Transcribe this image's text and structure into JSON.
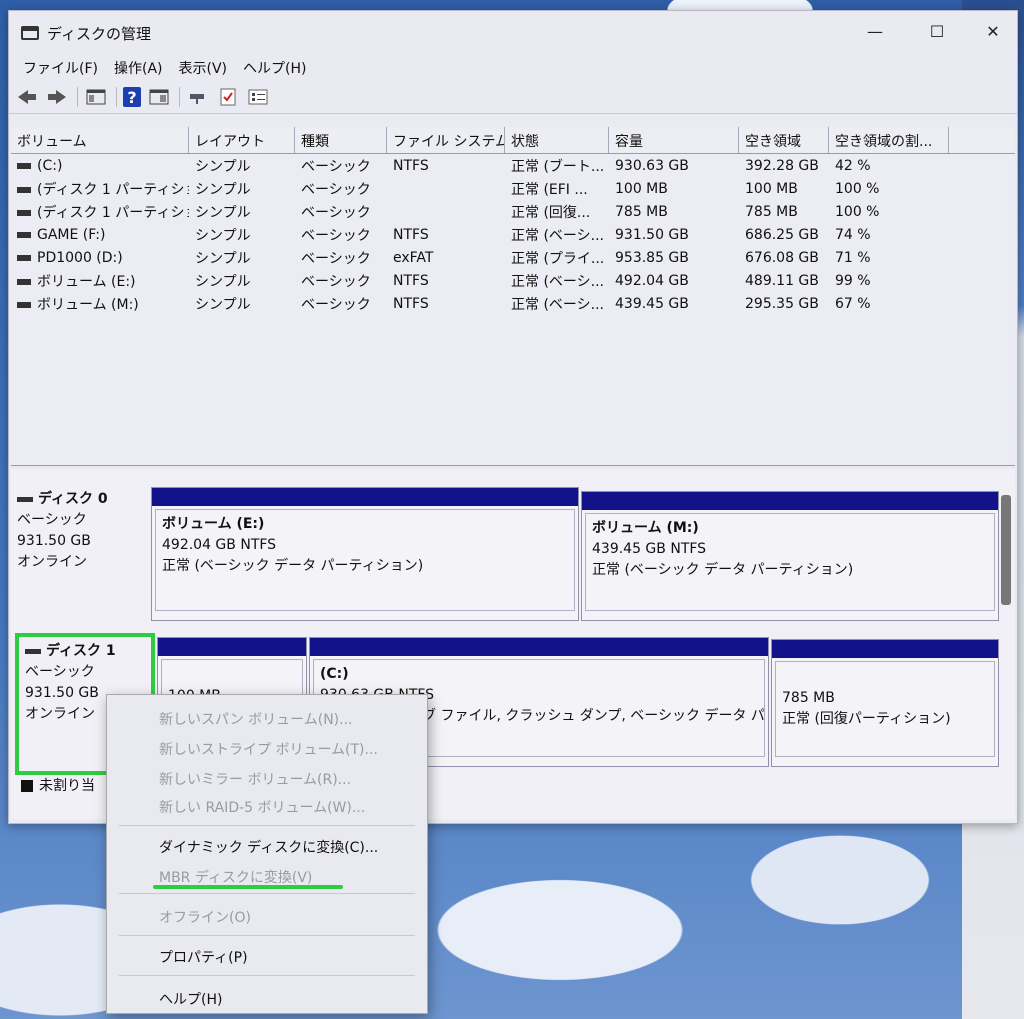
{
  "window": {
    "title": "ディスクの管理",
    "minimize": "—",
    "maximize": "☐",
    "close": "✕"
  },
  "menu": [
    "ファイル(F)",
    "操作(A)",
    "表示(V)",
    "ヘルプ(H)"
  ],
  "toolbar": {
    "help_glyph": "?"
  },
  "table": {
    "columns": [
      "ボリューム",
      "レイアウト",
      "種類",
      "ファイル システム",
      "状態",
      "容量",
      "空き領域",
      "空き領域の割..."
    ],
    "rows": [
      [
        "(C:)",
        "シンプル",
        "ベーシック",
        "NTFS",
        "正常 (ブート...",
        "930.63 GB",
        "392.28 GB",
        "42 %"
      ],
      [
        "(ディスク 1 パーティショ...",
        "シンプル",
        "ベーシック",
        "",
        "正常 (EFI ...",
        "100 MB",
        "100 MB",
        "100 %"
      ],
      [
        "(ディスク 1 パーティショ...",
        "シンプル",
        "ベーシック",
        "",
        "正常 (回復...",
        "785 MB",
        "785 MB",
        "100 %"
      ],
      [
        "GAME (F:)",
        "シンプル",
        "ベーシック",
        "NTFS",
        "正常 (ベーシ...",
        "931.50 GB",
        "686.25 GB",
        "74 %"
      ],
      [
        "PD1000 (D:)",
        "シンプル",
        "ベーシック",
        "exFAT",
        "正常 (プライ...",
        "953.85 GB",
        "676.08 GB",
        "71 %"
      ],
      [
        "ボリューム (E:)",
        "シンプル",
        "ベーシック",
        "NTFS",
        "正常 (ベーシ...",
        "492.04 GB",
        "489.11 GB",
        "99 %"
      ],
      [
        "ボリューム (M:)",
        "シンプル",
        "ベーシック",
        "NTFS",
        "正常 (ベーシ...",
        "439.45 GB",
        "295.35 GB",
        "67 %"
      ]
    ]
  },
  "disk0": {
    "name": "ディスク 0",
    "type": "ベーシック",
    "size": "931.50 GB",
    "status": "オンライン",
    "p1": {
      "name": "ボリューム (E:)",
      "size": "492.04 GB NTFS",
      "status": "正常 (ベーシック データ パーティション)"
    },
    "p2": {
      "name": "ボリューム (M:)",
      "size": "439.45 GB NTFS",
      "status": "正常 (ベーシック データ パーティション)"
    }
  },
  "disk1": {
    "name": "ディスク 1",
    "type": "ベーシック",
    "size": "931.50 GB",
    "status": "オンライン",
    "p1": {
      "size": "100 MB"
    },
    "p2": {
      "name": "(C:)",
      "size": "930.63 GB NTFS",
      "status": "ブ ファイル, クラッシュ ダンプ, ベーシック データ パーティショ"
    },
    "p3": {
      "size": "785 MB",
      "status": "正常 (回復パーティション)"
    }
  },
  "legend": {
    "unallocated": "未割り当"
  },
  "context_menu": {
    "new_spanned": "新しいスパン ボリューム(N)...",
    "new_striped": "新しいストライプ ボリューム(T)...",
    "new_mirrored": "新しいミラー ボリューム(R)...",
    "new_raid5": "新しい RAID-5 ボリューム(W)...",
    "convert_dynamic": "ダイナミック ディスクに変換(C)...",
    "convert_mbr": "MBR ディスクに変換(V)",
    "offline": "オフライン(O)",
    "properties": "プロパティ(P)",
    "help": "ヘルプ(H)"
  },
  "colors": {
    "partition_bar": "#12128a",
    "highlight": "#2ecc40"
  }
}
